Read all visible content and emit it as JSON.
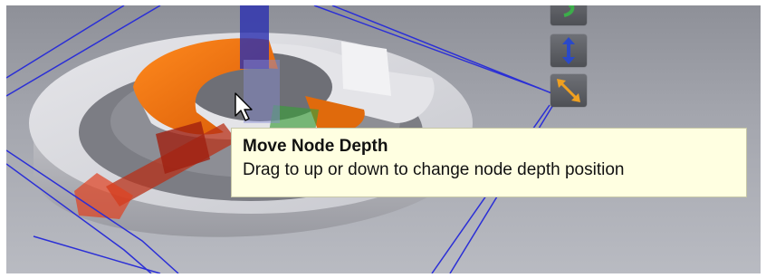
{
  "tooltip": {
    "title": "Move Node Depth",
    "description": "Drag to up or down to change node depth position"
  },
  "gizmo_toolbar": {
    "buttons": [
      {
        "name": "rotate",
        "icon": "curved-arrow-icon",
        "color": "#3cae4a"
      },
      {
        "name": "move-depth",
        "icon": "up-down-arrow-icon",
        "color": "#2a49c9"
      },
      {
        "name": "move-diagonal",
        "icon": "diagonal-arrow-icon",
        "color": "#f0a020"
      }
    ]
  },
  "colors": {
    "selection_bounds": "#2b2fd6",
    "node_highlight": "#f07010",
    "tooltip_bg": "#ffffe1"
  }
}
